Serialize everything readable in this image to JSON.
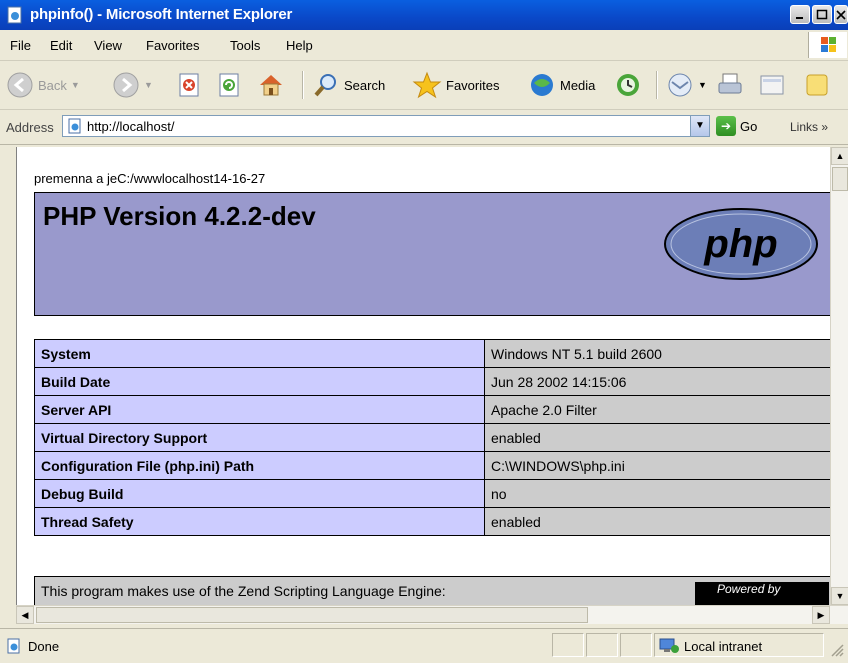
{
  "window": {
    "title": "phpinfo() - Microsoft Internet Explorer"
  },
  "menu": [
    "File",
    "Edit",
    "View",
    "Favorites",
    "Tools",
    "Help"
  ],
  "toolbar": {
    "back": "Back",
    "search": "Search",
    "favorites": "Favorites",
    "media": "Media"
  },
  "address": {
    "label": "Address",
    "url": "http://localhost/",
    "go": "Go",
    "links": "Links"
  },
  "page": {
    "notice": "premenna a jeC:/wwwlocalhost14-16-27",
    "version": "PHP Version 4.2.2-dev",
    "logo_text": "php",
    "rows": [
      {
        "key": "System",
        "value": "Windows NT 5.1 build 2600"
      },
      {
        "key": "Build Date",
        "value": "Jun 28 2002 14:15:06"
      },
      {
        "key": "Server API",
        "value": "Apache 2.0 Filter"
      },
      {
        "key": "Virtual Directory Support",
        "value": "enabled"
      },
      {
        "key": "Configuration File (php.ini) Path",
        "value": "C:\\WINDOWS\\php.ini"
      },
      {
        "key": "Debug Build",
        "value": "no"
      },
      {
        "key": "Thread Safety",
        "value": "enabled"
      }
    ],
    "zend_text": "This program makes use of the Zend Scripting Language Engine:",
    "zend_logo": "Powered by"
  },
  "status": {
    "text": "Done",
    "zone": "Local intranet"
  },
  "colors": {
    "title_bar": "#0a48c8",
    "php_header": "#9999cc",
    "key_cell": "#ccccff",
    "value_cell": "#cccccc"
  }
}
